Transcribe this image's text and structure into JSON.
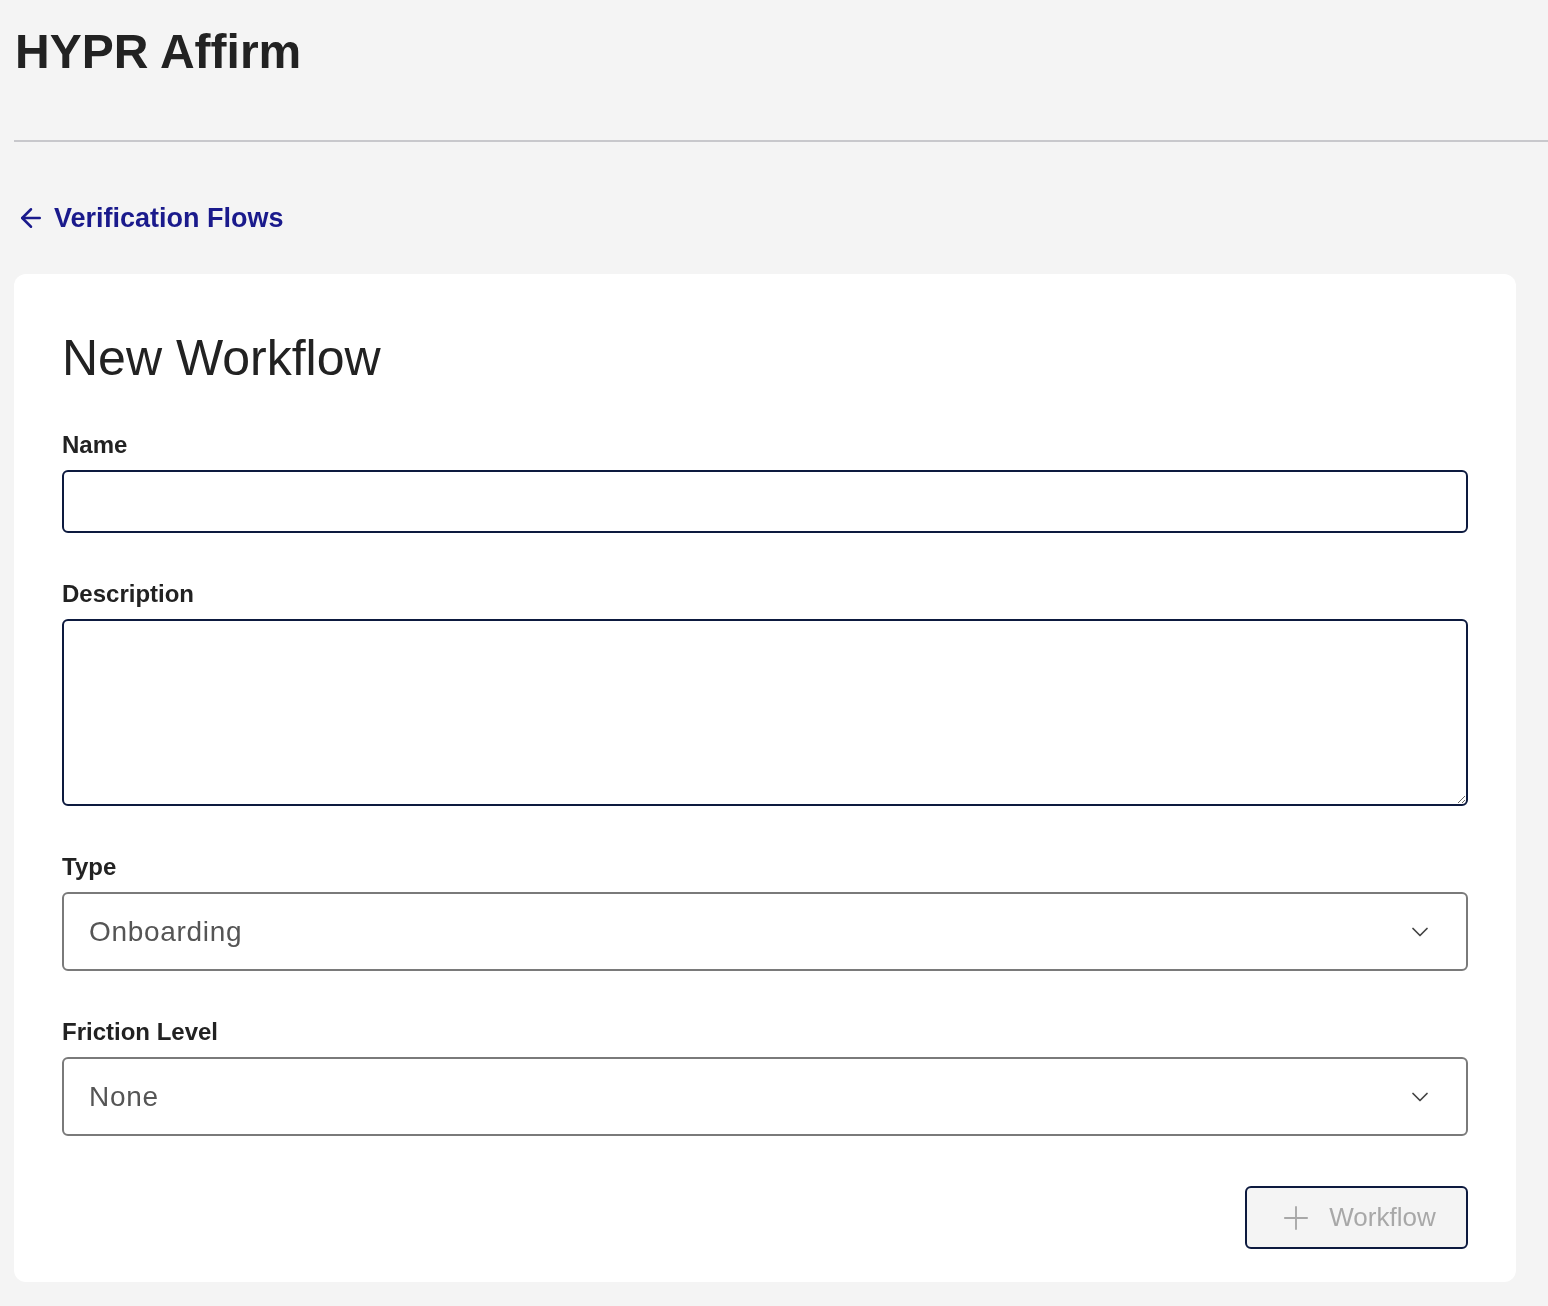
{
  "header": {
    "title": "HYPR Affirm"
  },
  "back_link": {
    "label": "Verification Flows"
  },
  "form": {
    "title": "New Workflow",
    "fields": [
      {
        "kind": "text",
        "label": "Name"
      },
      {
        "kind": "textarea",
        "label": "Description"
      },
      {
        "kind": "select",
        "label": "Type",
        "value": "Onboarding"
      },
      {
        "kind": "select",
        "label": "Friction Level",
        "value": "None"
      }
    ],
    "submit": {
      "label": "Workflow",
      "disabled": true
    }
  }
}
